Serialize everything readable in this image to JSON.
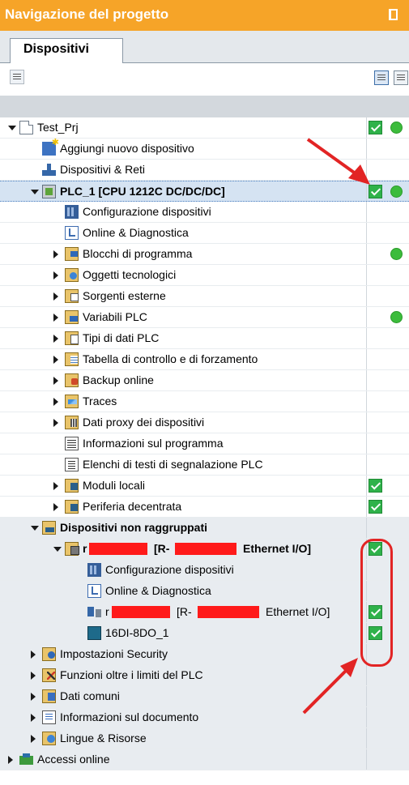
{
  "panel": {
    "title": "Navigazione del progetto",
    "tab_label": "Dispositivi"
  },
  "tree": [
    {
      "label": "Test_Prj",
      "indent": 0,
      "arrow": "down",
      "icon": "project-icon",
      "bold": false,
      "check": true,
      "dot": true
    },
    {
      "label": "Aggiungi nuovo dispositivo",
      "indent": 1,
      "arrow": "none",
      "icon": "add-device-icon",
      "bold": false,
      "check": false,
      "dot": false
    },
    {
      "label": "Dispositivi & Reti",
      "indent": 1,
      "arrow": "none",
      "icon": "network-icon",
      "bold": false,
      "check": false,
      "dot": false
    },
    {
      "label": "PLC_1 [CPU 1212C DC/DC/DC]",
      "indent": 1,
      "arrow": "down",
      "icon": "plc-icon",
      "bold": true,
      "check": true,
      "dot": true,
      "selected": true
    },
    {
      "label": "Configurazione dispositivi",
      "indent": 2,
      "arrow": "none",
      "icon": "device-config-icon",
      "bold": false,
      "check": false,
      "dot": false
    },
    {
      "label": "Online & Diagnostica",
      "indent": 2,
      "arrow": "none",
      "icon": "diagnostics-icon",
      "bold": false,
      "check": false,
      "dot": false
    },
    {
      "label": "Blocchi di programma",
      "indent": 2,
      "arrow": "right",
      "icon": "program-blocks-icon",
      "bold": false,
      "check": false,
      "dot": true
    },
    {
      "label": "Oggetti tecnologici",
      "indent": 2,
      "arrow": "right",
      "icon": "technology-objects-icon",
      "bold": false,
      "check": false,
      "dot": false
    },
    {
      "label": "Sorgenti esterne",
      "indent": 2,
      "arrow": "right",
      "icon": "external-sources-icon",
      "bold": false,
      "check": false,
      "dot": false
    },
    {
      "label": "Variabili PLC",
      "indent": 2,
      "arrow": "right",
      "icon": "plc-tags-icon",
      "bold": false,
      "check": false,
      "dot": true
    },
    {
      "label": "Tipi di dati PLC",
      "indent": 2,
      "arrow": "right",
      "icon": "plc-data-types-icon",
      "bold": false,
      "check": false,
      "dot": false
    },
    {
      "label": "Tabella di controllo e di forzamento",
      "indent": 2,
      "arrow": "right",
      "icon": "watch-table-icon",
      "bold": false,
      "check": false,
      "dot": false
    },
    {
      "label": "Backup online",
      "indent": 2,
      "arrow": "right",
      "icon": "backup-icon",
      "bold": false,
      "check": false,
      "dot": false
    },
    {
      "label": "Traces",
      "indent": 2,
      "arrow": "right",
      "icon": "traces-icon",
      "bold": false,
      "check": false,
      "dot": false
    },
    {
      "label": "Dati proxy dei dispositivi",
      "indent": 2,
      "arrow": "right",
      "icon": "device-proxy-icon",
      "bold": false,
      "check": false,
      "dot": false
    },
    {
      "label": "Informazioni sul programma",
      "indent": 2,
      "arrow": "none",
      "icon": "program-info-icon",
      "bold": false,
      "check": false,
      "dot": false
    },
    {
      "label": "Elenchi di testi di segnalazione PLC",
      "indent": 2,
      "arrow": "none",
      "icon": "text-lists-icon",
      "bold": false,
      "check": false,
      "dot": false
    },
    {
      "label": "Moduli locali",
      "indent": 2,
      "arrow": "right",
      "icon": "local-modules-icon",
      "bold": false,
      "check": true,
      "dot": false
    },
    {
      "label": "Periferia decentrata",
      "indent": 2,
      "arrow": "right",
      "icon": "distributed-io-icon",
      "bold": false,
      "check": true,
      "dot": false
    },
    {
      "label": "Dispositivi non raggruppati",
      "indent": 1,
      "arrow": "down",
      "icon": "ungrouped-devices-icon",
      "bold": true,
      "check": false,
      "dot": false,
      "dark": true
    },
    {
      "label": "r",
      "suffix": "[R-",
      "suffix2": "Ethernet I/O]",
      "indent": 2,
      "arrow": "down",
      "icon": "io-device-icon",
      "bold": true,
      "check": true,
      "dot": false,
      "dark": true,
      "redacted": true
    },
    {
      "label": "Configurazione dispositivi",
      "indent": 3,
      "arrow": "none",
      "icon": "device-config-icon",
      "bold": false,
      "check": false,
      "dot": false,
      "dark": true
    },
    {
      "label": "Online & Diagnostica",
      "indent": 3,
      "arrow": "none",
      "icon": "diagnostics-icon",
      "bold": false,
      "check": false,
      "dot": false,
      "dark": true
    },
    {
      "label": "r",
      "suffix": "[R-",
      "suffix2": "Ethernet I/O]",
      "indent": 3,
      "arrow": "none",
      "icon": "io-module-icon",
      "bold": false,
      "check": true,
      "dot": false,
      "dark": true,
      "redacted": true
    },
    {
      "label": "16DI-8DO_1",
      "indent": 3,
      "arrow": "none",
      "icon": "io-card-icon",
      "bold": false,
      "check": true,
      "dot": false,
      "dark": true
    },
    {
      "label": "Impostazioni Security",
      "indent": 1,
      "arrow": "right",
      "icon": "security-icon",
      "bold": false,
      "check": false,
      "dot": false,
      "dark": true
    },
    {
      "label": "Funzioni oltre i limiti del PLC",
      "indent": 1,
      "arrow": "right",
      "icon": "cross-plc-icon",
      "bold": false,
      "check": false,
      "dot": false,
      "dark": true
    },
    {
      "label": "Dati comuni",
      "indent": 1,
      "arrow": "right",
      "icon": "common-data-icon",
      "bold": false,
      "check": false,
      "dot": false,
      "dark": true
    },
    {
      "label": "Informazioni sul documento",
      "indent": 1,
      "arrow": "right",
      "icon": "document-info-icon",
      "bold": false,
      "check": false,
      "dot": false,
      "dark": true
    },
    {
      "label": "Lingue & Risorse",
      "indent": 1,
      "arrow": "right",
      "icon": "languages-icon",
      "bold": false,
      "check": false,
      "dot": false,
      "dark": true
    },
    {
      "label": "Accessi online",
      "indent": 0,
      "arrow": "right",
      "icon": "online-access-icon",
      "bold": false,
      "check": false,
      "dot": false,
      "dark": true
    }
  ],
  "colors": {
    "title_bar": "#f6a428",
    "selected_row": "#d5e3f2",
    "ok_green": "#2fb24a",
    "annotation_red": "#e22424",
    "redaction_red": "#ff1a1a"
  }
}
